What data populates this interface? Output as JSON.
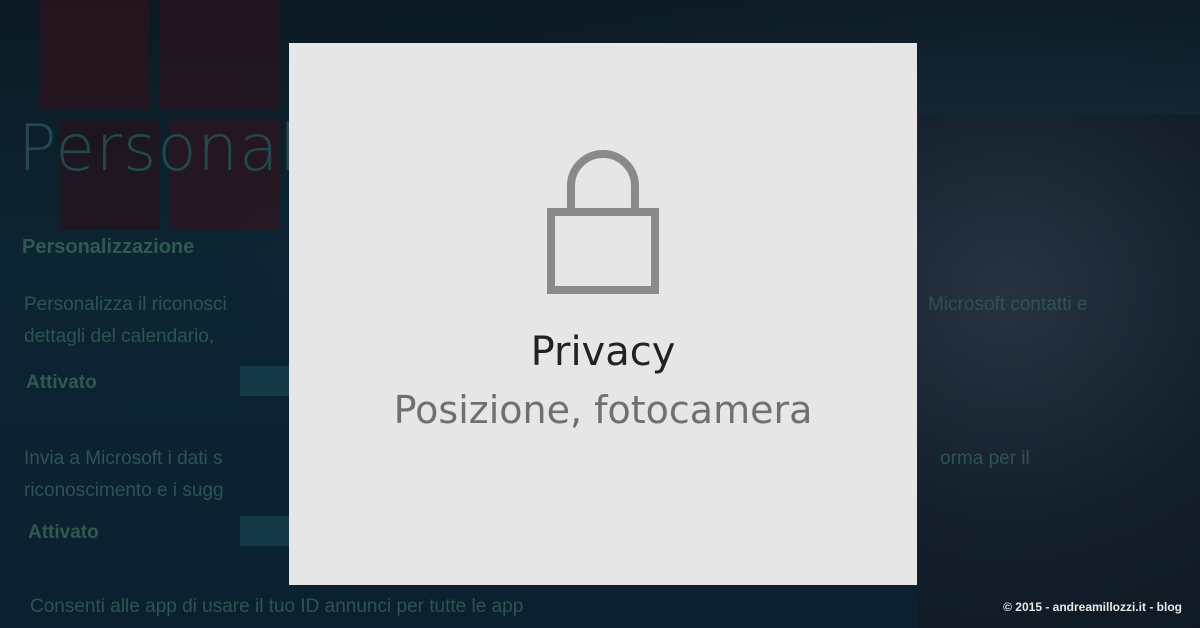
{
  "background": {
    "page_title": "Personalizz",
    "section_heading": "Personalizzazione",
    "text_block_1_line_1": "Personalizza il riconosci",
    "text_block_1_line_2": "dettagli del calendario,",
    "text_block_1_right": "Microsoft contatti e",
    "toggle_1_label": "Attivato",
    "text_block_2_line_1": "Invia a Microsoft i dati s",
    "text_block_2_line_2": "riconoscimento e i sugg",
    "text_block_2_right": "orma per il",
    "toggle_2_label": "Attivato",
    "bottom_text": "Consenti alle app di usare il tuo ID annunci per tutte le app"
  },
  "card": {
    "title": "Privacy",
    "subtitle": "Posizione, fotocamera",
    "icon": "lock-icon"
  },
  "watermark": {
    "copyright": "© 2015 - andreamillozzi.it - blog"
  },
  "colors": {
    "card_background": "#e6e6e6",
    "lock_stroke": "#8a8a8a",
    "title": "#222222",
    "subtitle": "#707070"
  }
}
